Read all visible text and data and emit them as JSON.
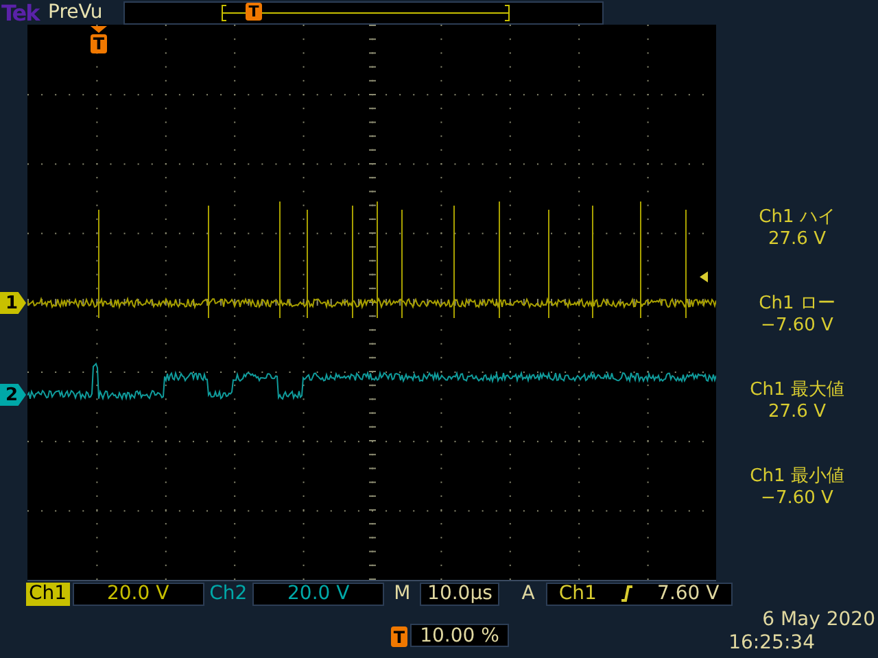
{
  "header": {
    "brand": "Tek",
    "mode": "PreVu",
    "trigger_marker": "T"
  },
  "screen": {
    "trigger_marker": "T"
  },
  "channels": [
    {
      "label": "Ch1",
      "marker": "1",
      "scale": "20.0 V",
      "color": "#c8c000",
      "selected": true
    },
    {
      "label": "Ch2",
      "marker": "2",
      "scale": "20.0 V",
      "color": "#00a8a8",
      "selected": false
    }
  ],
  "timebase": {
    "label": "M",
    "value": "10.0µs"
  },
  "trigger": {
    "label": "A",
    "source": "Ch1",
    "level": "7.60 V"
  },
  "trigger_position": {
    "marker": "T",
    "value": "10.00 %"
  },
  "measurements": [
    {
      "label": "Ch1 ハイ",
      "value": "27.6 V"
    },
    {
      "label": "Ch1 ロー",
      "value": "−7.60 V"
    },
    {
      "label": "Ch1 最大値",
      "value": "27.6 V"
    },
    {
      "label": "Ch1 最小値",
      "value": "−7.60 V"
    }
  ],
  "date": "6 May 2020",
  "time": "16:25:34"
}
